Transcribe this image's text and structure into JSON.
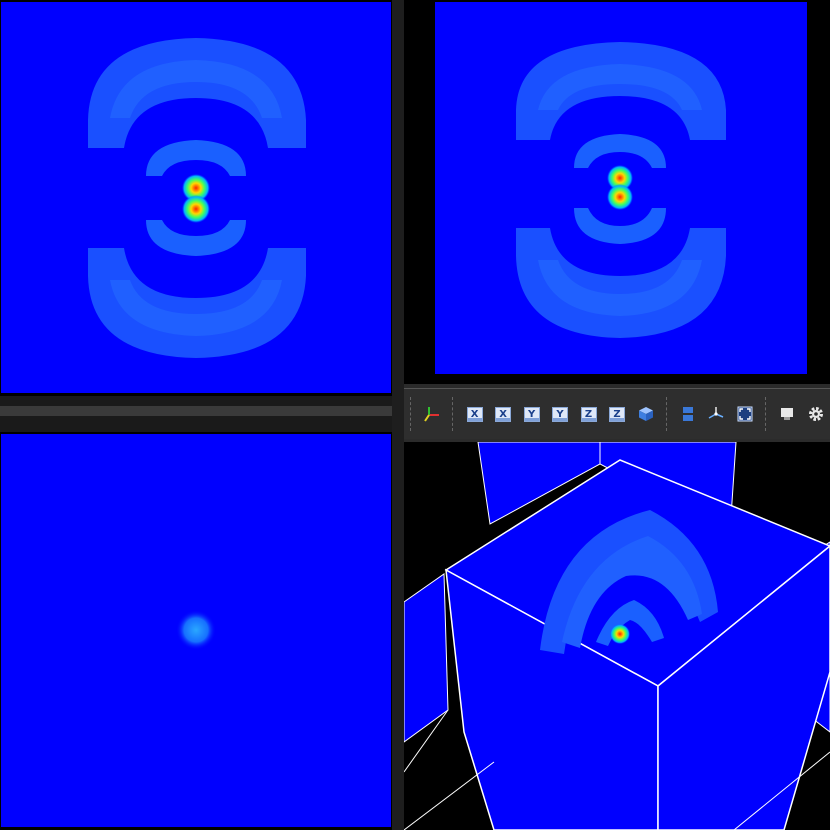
{
  "views": {
    "top_left": {
      "name": "slice-view-1"
    },
    "top_right": {
      "name": "slice-view-2"
    },
    "bottom_left": {
      "name": "slice-view-3"
    },
    "bottom_right": {
      "name": "3d-view"
    }
  },
  "colors": {
    "background_field": "#0000ff",
    "pane_background": "#000000",
    "toolbar_background": "#2e2e2e"
  },
  "toolbar": {
    "buttons": [
      {
        "id": "orientation-axes",
        "icon": "orientation-axes-icon"
      },
      {
        "id": "view-neg-x",
        "label": "X",
        "icon": "view-minus-x-icon"
      },
      {
        "id": "view-pos-x",
        "label": "X",
        "icon": "view-plus-x-icon"
      },
      {
        "id": "view-neg-y",
        "label": "Y",
        "icon": "view-minus-y-icon"
      },
      {
        "id": "view-pos-y",
        "label": "Y",
        "icon": "view-plus-y-icon"
      },
      {
        "id": "view-neg-z",
        "label": "Z",
        "icon": "view-minus-z-icon"
      },
      {
        "id": "view-pos-z",
        "label": "Z",
        "icon": "view-plus-z-icon"
      },
      {
        "id": "view-iso",
        "icon": "isometric-cube-icon"
      },
      {
        "id": "layout",
        "icon": "split-layout-icon"
      },
      {
        "id": "reset-center",
        "icon": "center-axes-icon"
      },
      {
        "id": "zoom-fit",
        "icon": "zoom-to-fit-icon"
      },
      {
        "id": "capture",
        "icon": "camera-capture-icon"
      },
      {
        "id": "settings",
        "icon": "gear-icon"
      }
    ]
  }
}
